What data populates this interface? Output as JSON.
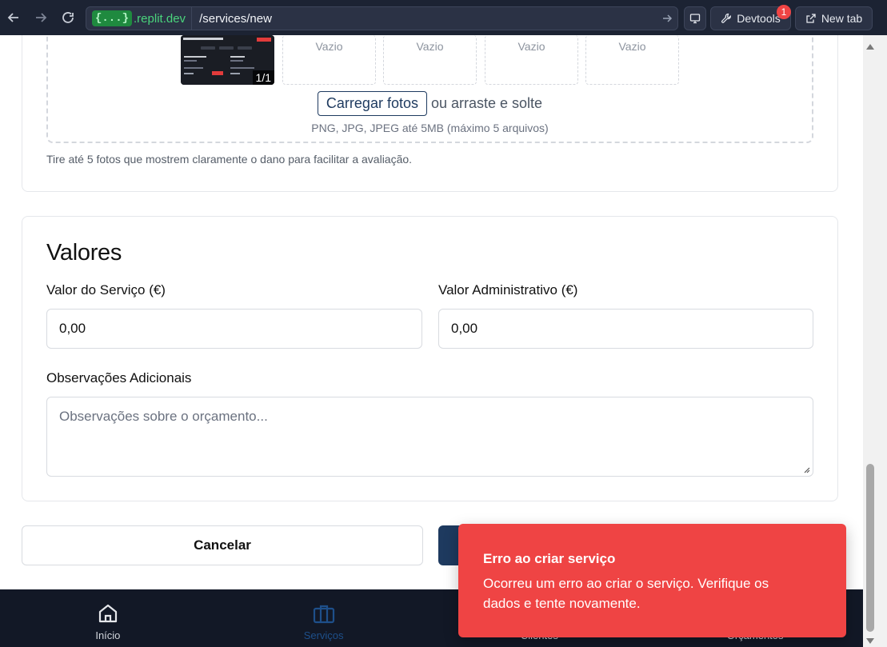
{
  "browser": {
    "domain_badge": "{...}",
    "domain": ".replit.dev",
    "path": "/services/new",
    "devtools_label": "Devtools",
    "devtools_badge": "1",
    "new_tab_label": "New tab"
  },
  "photos": {
    "counter": "1/1",
    "empty_slots": [
      "Vazio",
      "Vazio",
      "Vazio",
      "Vazio"
    ],
    "upload_button": "Carregar fotos",
    "upload_suffix": "ou arraste e solte",
    "upload_hint": "PNG, JPG, JPEG até 5MB (máximo 5 arquivos)",
    "helper": "Tire até 5 fotos que mostrem claramente o dano para facilitar a avaliação."
  },
  "valores": {
    "title": "Valores",
    "service_label": "Valor do Serviço (€)",
    "service_value": "0,00",
    "admin_label": "Valor Administrativo (€)",
    "admin_value": "0,00",
    "notes_label": "Observações Adicionais",
    "notes_placeholder": "Observações sobre o orçamento..."
  },
  "actions": {
    "cancel": "Cancelar"
  },
  "bottom_nav": [
    {
      "label": "Início",
      "icon": "home-icon"
    },
    {
      "label": "Serviços",
      "icon": "briefcase-icon"
    },
    {
      "label": "Clientes",
      "icon": "users-icon"
    },
    {
      "label": "Orçamentos",
      "icon": "document-icon"
    }
  ],
  "toast": {
    "title": "Erro ao criar serviço",
    "message": "Ocorreu um erro ao criar o serviço. Verifique os dados e tente novamente."
  },
  "colors": {
    "topbar": "#1c2333",
    "primary": "#1e3a5f",
    "toast": "#ef4444",
    "bottom_nav": "#121826"
  }
}
